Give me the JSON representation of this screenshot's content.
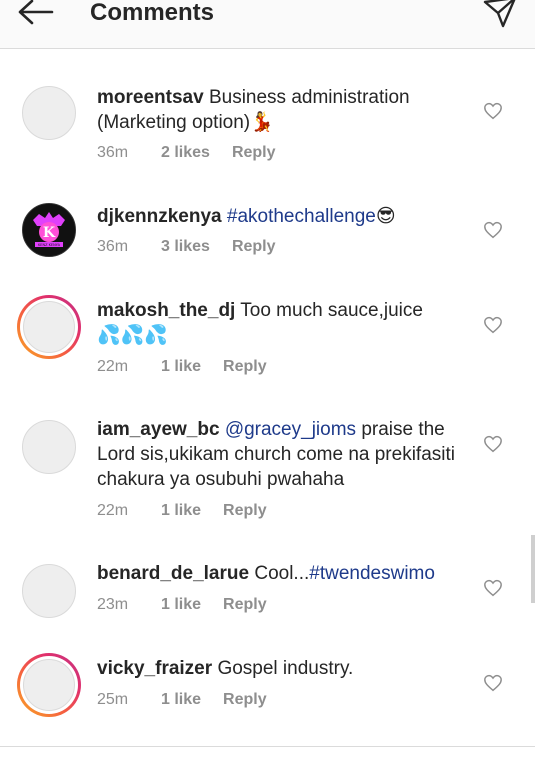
{
  "header": {
    "title": "Comments"
  },
  "comments": [
    {
      "username": "moreentsav",
      "text_pre": "Business administration (Marketing option)",
      "emoji": "💃",
      "time": "36m",
      "likes": "2 likes",
      "reply": "Reply"
    },
    {
      "username": "djkennzkenya",
      "hashtag": "#akothechallenge",
      "emoji": "😎",
      "time": "36m",
      "likes": "3 likes",
      "reply": "Reply",
      "avatar_letter": "K",
      "avatar_caption": "KENZ KENYA"
    },
    {
      "username": "makosh_the_dj",
      "text_pre": "Too much sauce,juice",
      "emoji": "💦💦💦",
      "time": "22m",
      "likes": "1 like",
      "reply": "Reply"
    },
    {
      "username": "iam_ayew_bc",
      "mention": "@gracey_jioms",
      "text_post": "praise the Lord sis,ukikam church come na prekifasiti chakura ya osubuhi pwahaha",
      "time": "22m",
      "likes": "1 like",
      "reply": "Reply"
    },
    {
      "username": "benard_de_larue",
      "text_pre": "Cool...",
      "hashtag": "#twendeswimo",
      "time": "23m",
      "likes": "1 like",
      "reply": "Reply"
    },
    {
      "username": "vicky_fraizer",
      "text_pre": "Gospel industry.",
      "time": "25m",
      "likes": "1 like",
      "reply": "Reply"
    }
  ],
  "icons": {
    "back": "arrow-left-icon",
    "send": "paper-plane-icon",
    "like": "heart-outline-icon"
  },
  "colors": {
    "hashtag": "#1e3a8a",
    "meta": "#8e8e8e",
    "text": "#262626"
  }
}
